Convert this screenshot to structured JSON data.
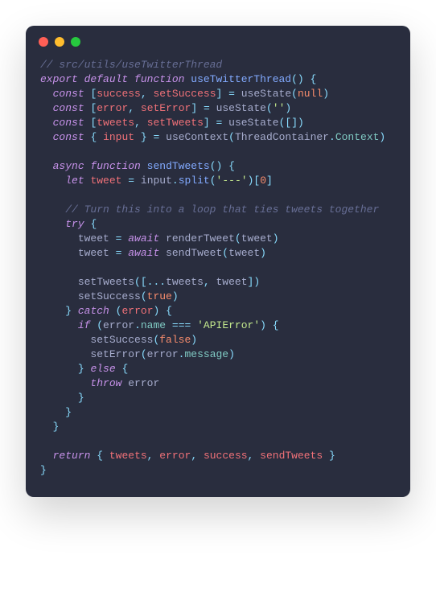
{
  "code": {
    "lines": [
      [
        {
          "t": "// src/utils/useTwitterThread",
          "c": "c-comment"
        }
      ],
      [
        {
          "t": "export",
          "c": "c-keyword"
        },
        {
          "t": " ",
          "c": "c-plain"
        },
        {
          "t": "default",
          "c": "c-keyword"
        },
        {
          "t": " ",
          "c": "c-plain"
        },
        {
          "t": "function",
          "c": "c-keyword"
        },
        {
          "t": " ",
          "c": "c-plain"
        },
        {
          "t": "useTwitterThread",
          "c": "c-func"
        },
        {
          "t": "(",
          "c": "c-punct"
        },
        {
          "t": ")",
          "c": "c-punct"
        },
        {
          "t": " ",
          "c": "c-plain"
        },
        {
          "t": "{",
          "c": "c-punct"
        }
      ],
      [
        {
          "t": "  ",
          "c": "c-plain"
        },
        {
          "t": "const",
          "c": "c-keyword"
        },
        {
          "t": " ",
          "c": "c-plain"
        },
        {
          "t": "[",
          "c": "c-punct"
        },
        {
          "t": "success",
          "c": "c-var"
        },
        {
          "t": ",",
          "c": "c-punct"
        },
        {
          "t": " ",
          "c": "c-plain"
        },
        {
          "t": "setSuccess",
          "c": "c-var"
        },
        {
          "t": "]",
          "c": "c-punct"
        },
        {
          "t": " ",
          "c": "c-plain"
        },
        {
          "t": "=",
          "c": "c-op"
        },
        {
          "t": " ",
          "c": "c-plain"
        },
        {
          "t": "useState",
          "c": "c-plain"
        },
        {
          "t": "(",
          "c": "c-punct"
        },
        {
          "t": "null",
          "c": "c-const"
        },
        {
          "t": ")",
          "c": "c-punct"
        }
      ],
      [
        {
          "t": "  ",
          "c": "c-plain"
        },
        {
          "t": "const",
          "c": "c-keyword"
        },
        {
          "t": " ",
          "c": "c-plain"
        },
        {
          "t": "[",
          "c": "c-punct"
        },
        {
          "t": "error",
          "c": "c-var"
        },
        {
          "t": ",",
          "c": "c-punct"
        },
        {
          "t": " ",
          "c": "c-plain"
        },
        {
          "t": "setError",
          "c": "c-var"
        },
        {
          "t": "]",
          "c": "c-punct"
        },
        {
          "t": " ",
          "c": "c-plain"
        },
        {
          "t": "=",
          "c": "c-op"
        },
        {
          "t": " ",
          "c": "c-plain"
        },
        {
          "t": "useState",
          "c": "c-plain"
        },
        {
          "t": "(",
          "c": "c-punct"
        },
        {
          "t": "''",
          "c": "c-str"
        },
        {
          "t": ")",
          "c": "c-punct"
        }
      ],
      [
        {
          "t": "  ",
          "c": "c-plain"
        },
        {
          "t": "const",
          "c": "c-keyword"
        },
        {
          "t": " ",
          "c": "c-plain"
        },
        {
          "t": "[",
          "c": "c-punct"
        },
        {
          "t": "tweets",
          "c": "c-var"
        },
        {
          "t": ",",
          "c": "c-punct"
        },
        {
          "t": " ",
          "c": "c-plain"
        },
        {
          "t": "setTweets",
          "c": "c-var"
        },
        {
          "t": "]",
          "c": "c-punct"
        },
        {
          "t": " ",
          "c": "c-plain"
        },
        {
          "t": "=",
          "c": "c-op"
        },
        {
          "t": " ",
          "c": "c-plain"
        },
        {
          "t": "useState",
          "c": "c-plain"
        },
        {
          "t": "(",
          "c": "c-punct"
        },
        {
          "t": "[",
          "c": "c-punct"
        },
        {
          "t": "]",
          "c": "c-punct"
        },
        {
          "t": ")",
          "c": "c-punct"
        }
      ],
      [
        {
          "t": "  ",
          "c": "c-plain"
        },
        {
          "t": "const",
          "c": "c-keyword"
        },
        {
          "t": " ",
          "c": "c-plain"
        },
        {
          "t": "{",
          "c": "c-punct"
        },
        {
          "t": " ",
          "c": "c-plain"
        },
        {
          "t": "input",
          "c": "c-var"
        },
        {
          "t": " ",
          "c": "c-plain"
        },
        {
          "t": "}",
          "c": "c-punct"
        },
        {
          "t": " ",
          "c": "c-plain"
        },
        {
          "t": "=",
          "c": "c-op"
        },
        {
          "t": " ",
          "c": "c-plain"
        },
        {
          "t": "useContext",
          "c": "c-plain"
        },
        {
          "t": "(",
          "c": "c-punct"
        },
        {
          "t": "ThreadContainer",
          "c": "c-plain"
        },
        {
          "t": ".",
          "c": "c-punct"
        },
        {
          "t": "Context",
          "c": "c-prop"
        },
        {
          "t": ")",
          "c": "c-punct"
        }
      ],
      [],
      [
        {
          "t": "  ",
          "c": "c-plain"
        },
        {
          "t": "async",
          "c": "c-keyword"
        },
        {
          "t": " ",
          "c": "c-plain"
        },
        {
          "t": "function",
          "c": "c-keyword"
        },
        {
          "t": " ",
          "c": "c-plain"
        },
        {
          "t": "sendTweets",
          "c": "c-func"
        },
        {
          "t": "(",
          "c": "c-punct"
        },
        {
          "t": ")",
          "c": "c-punct"
        },
        {
          "t": " ",
          "c": "c-plain"
        },
        {
          "t": "{",
          "c": "c-punct"
        }
      ],
      [
        {
          "t": "    ",
          "c": "c-plain"
        },
        {
          "t": "let",
          "c": "c-keyword"
        },
        {
          "t": " ",
          "c": "c-plain"
        },
        {
          "t": "tweet",
          "c": "c-var"
        },
        {
          "t": " ",
          "c": "c-plain"
        },
        {
          "t": "=",
          "c": "c-op"
        },
        {
          "t": " ",
          "c": "c-plain"
        },
        {
          "t": "input",
          "c": "c-plain"
        },
        {
          "t": ".",
          "c": "c-punct"
        },
        {
          "t": "split",
          "c": "c-func"
        },
        {
          "t": "(",
          "c": "c-punct"
        },
        {
          "t": "'---'",
          "c": "c-str"
        },
        {
          "t": ")",
          "c": "c-punct"
        },
        {
          "t": "[",
          "c": "c-punct"
        },
        {
          "t": "0",
          "c": "c-num"
        },
        {
          "t": "]",
          "c": "c-punct"
        }
      ],
      [],
      [
        {
          "t": "    ",
          "c": "c-plain"
        },
        {
          "t": "// Turn this into a loop that ties tweets together",
          "c": "c-comment"
        }
      ],
      [
        {
          "t": "    ",
          "c": "c-plain"
        },
        {
          "t": "try",
          "c": "c-keyword"
        },
        {
          "t": " ",
          "c": "c-plain"
        },
        {
          "t": "{",
          "c": "c-punct"
        }
      ],
      [
        {
          "t": "      ",
          "c": "c-plain"
        },
        {
          "t": "tweet ",
          "c": "c-plain"
        },
        {
          "t": "=",
          "c": "c-op"
        },
        {
          "t": " ",
          "c": "c-plain"
        },
        {
          "t": "await",
          "c": "c-keyword"
        },
        {
          "t": " ",
          "c": "c-plain"
        },
        {
          "t": "renderTweet",
          "c": "c-plain"
        },
        {
          "t": "(",
          "c": "c-punct"
        },
        {
          "t": "tweet",
          "c": "c-plain"
        },
        {
          "t": ")",
          "c": "c-punct"
        }
      ],
      [
        {
          "t": "      ",
          "c": "c-plain"
        },
        {
          "t": "tweet ",
          "c": "c-plain"
        },
        {
          "t": "=",
          "c": "c-op"
        },
        {
          "t": " ",
          "c": "c-plain"
        },
        {
          "t": "await",
          "c": "c-keyword"
        },
        {
          "t": " ",
          "c": "c-plain"
        },
        {
          "t": "sendTweet",
          "c": "c-plain"
        },
        {
          "t": "(",
          "c": "c-punct"
        },
        {
          "t": "tweet",
          "c": "c-plain"
        },
        {
          "t": ")",
          "c": "c-punct"
        }
      ],
      [],
      [
        {
          "t": "      ",
          "c": "c-plain"
        },
        {
          "t": "setTweets",
          "c": "c-plain"
        },
        {
          "t": "(",
          "c": "c-punct"
        },
        {
          "t": "[",
          "c": "c-punct"
        },
        {
          "t": "...",
          "c": "c-punct"
        },
        {
          "t": "tweets",
          "c": "c-plain"
        },
        {
          "t": ",",
          "c": "c-punct"
        },
        {
          "t": " tweet",
          "c": "c-plain"
        },
        {
          "t": "]",
          "c": "c-punct"
        },
        {
          "t": ")",
          "c": "c-punct"
        }
      ],
      [
        {
          "t": "      ",
          "c": "c-plain"
        },
        {
          "t": "setSuccess",
          "c": "c-plain"
        },
        {
          "t": "(",
          "c": "c-punct"
        },
        {
          "t": "true",
          "c": "c-const"
        },
        {
          "t": ")",
          "c": "c-punct"
        }
      ],
      [
        {
          "t": "    ",
          "c": "c-plain"
        },
        {
          "t": "}",
          "c": "c-punct"
        },
        {
          "t": " ",
          "c": "c-plain"
        },
        {
          "t": "catch",
          "c": "c-keyword"
        },
        {
          "t": " ",
          "c": "c-plain"
        },
        {
          "t": "(",
          "c": "c-punct"
        },
        {
          "t": "error",
          "c": "c-var"
        },
        {
          "t": ")",
          "c": "c-punct"
        },
        {
          "t": " ",
          "c": "c-plain"
        },
        {
          "t": "{",
          "c": "c-punct"
        }
      ],
      [
        {
          "t": "      ",
          "c": "c-plain"
        },
        {
          "t": "if",
          "c": "c-keyword"
        },
        {
          "t": " ",
          "c": "c-plain"
        },
        {
          "t": "(",
          "c": "c-punct"
        },
        {
          "t": "error",
          "c": "c-plain"
        },
        {
          "t": ".",
          "c": "c-punct"
        },
        {
          "t": "name",
          "c": "c-prop"
        },
        {
          "t": " ",
          "c": "c-plain"
        },
        {
          "t": "===",
          "c": "c-op"
        },
        {
          "t": " ",
          "c": "c-plain"
        },
        {
          "t": "'APIError'",
          "c": "c-str"
        },
        {
          "t": ")",
          "c": "c-punct"
        },
        {
          "t": " ",
          "c": "c-plain"
        },
        {
          "t": "{",
          "c": "c-punct"
        }
      ],
      [
        {
          "t": "        ",
          "c": "c-plain"
        },
        {
          "t": "setSuccess",
          "c": "c-plain"
        },
        {
          "t": "(",
          "c": "c-punct"
        },
        {
          "t": "false",
          "c": "c-const"
        },
        {
          "t": ")",
          "c": "c-punct"
        }
      ],
      [
        {
          "t": "        ",
          "c": "c-plain"
        },
        {
          "t": "setError",
          "c": "c-plain"
        },
        {
          "t": "(",
          "c": "c-punct"
        },
        {
          "t": "error",
          "c": "c-plain"
        },
        {
          "t": ".",
          "c": "c-punct"
        },
        {
          "t": "message",
          "c": "c-prop"
        },
        {
          "t": ")",
          "c": "c-punct"
        }
      ],
      [
        {
          "t": "      ",
          "c": "c-plain"
        },
        {
          "t": "}",
          "c": "c-punct"
        },
        {
          "t": " ",
          "c": "c-plain"
        },
        {
          "t": "else",
          "c": "c-keyword"
        },
        {
          "t": " ",
          "c": "c-plain"
        },
        {
          "t": "{",
          "c": "c-punct"
        }
      ],
      [
        {
          "t": "        ",
          "c": "c-plain"
        },
        {
          "t": "throw",
          "c": "c-keyword"
        },
        {
          "t": " error",
          "c": "c-plain"
        }
      ],
      [
        {
          "t": "      ",
          "c": "c-plain"
        },
        {
          "t": "}",
          "c": "c-punct"
        }
      ],
      [
        {
          "t": "    ",
          "c": "c-plain"
        },
        {
          "t": "}",
          "c": "c-punct"
        }
      ],
      [
        {
          "t": "  ",
          "c": "c-plain"
        },
        {
          "t": "}",
          "c": "c-punct"
        }
      ],
      [],
      [
        {
          "t": "  ",
          "c": "c-plain"
        },
        {
          "t": "return",
          "c": "c-keyword"
        },
        {
          "t": " ",
          "c": "c-plain"
        },
        {
          "t": "{",
          "c": "c-punct"
        },
        {
          "t": " ",
          "c": "c-plain"
        },
        {
          "t": "tweets",
          "c": "c-var"
        },
        {
          "t": ",",
          "c": "c-punct"
        },
        {
          "t": " ",
          "c": "c-plain"
        },
        {
          "t": "error",
          "c": "c-var"
        },
        {
          "t": ",",
          "c": "c-punct"
        },
        {
          "t": " ",
          "c": "c-plain"
        },
        {
          "t": "success",
          "c": "c-var"
        },
        {
          "t": ",",
          "c": "c-punct"
        },
        {
          "t": " ",
          "c": "c-plain"
        },
        {
          "t": "sendTweets",
          "c": "c-var"
        },
        {
          "t": " ",
          "c": "c-plain"
        },
        {
          "t": "}",
          "c": "c-punct"
        }
      ],
      [
        {
          "t": "}",
          "c": "c-punct"
        }
      ]
    ]
  }
}
